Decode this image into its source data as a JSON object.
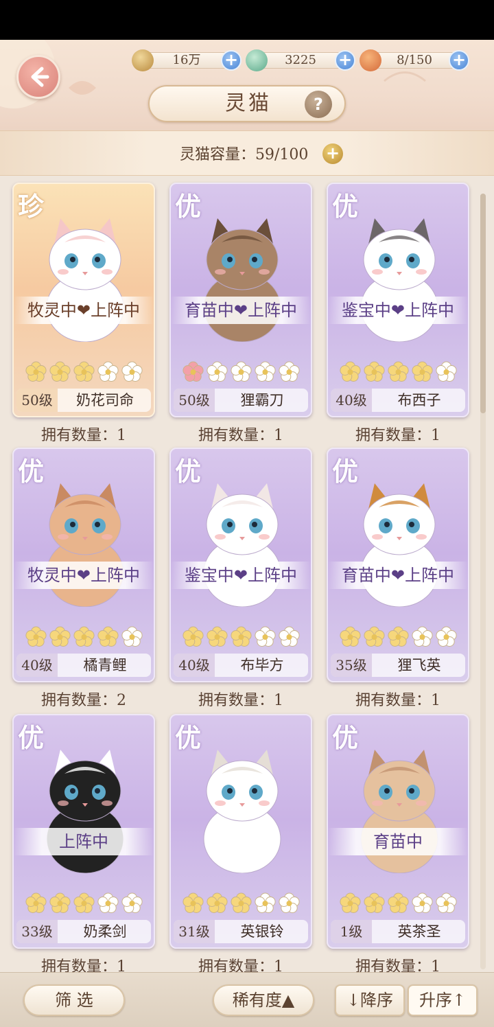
{
  "resources": [
    {
      "icon": "paw-coin-icon",
      "value": "16万"
    },
    {
      "icon": "jade-gem-icon",
      "value": "3225"
    },
    {
      "icon": "food-bowl-icon",
      "value": "8/150"
    }
  ],
  "header": {
    "title": "灵猫",
    "help": "?"
  },
  "capacity": {
    "text": "灵猫容量：59/100"
  },
  "cards": [
    {
      "rarity": "珍",
      "status": "牧灵中❤上阵中",
      "stars": 3,
      "level": "50级",
      "name": "奶花司命",
      "owned": "拥有数量：1"
    },
    {
      "rarity": "优",
      "status": "育苗中❤上阵中",
      "stars": 1,
      "level": "50级",
      "name": "狸霸刀",
      "owned": "拥有数量：1"
    },
    {
      "rarity": "优",
      "status": "鉴宝中❤上阵中",
      "stars": 4,
      "level": "40级",
      "name": "布西子",
      "owned": "拥有数量：1"
    },
    {
      "rarity": "优",
      "status": "牧灵中❤上阵中",
      "stars": 4,
      "level": "40级",
      "name": "橘青鲤",
      "owned": "拥有数量：2"
    },
    {
      "rarity": "优",
      "status": "鉴宝中❤上阵中",
      "stars": 3,
      "level": "40级",
      "name": "布毕方",
      "owned": "拥有数量：1"
    },
    {
      "rarity": "优",
      "status": "育苗中❤上阵中",
      "stars": 3,
      "level": "35级",
      "name": "狸飞英",
      "owned": "拥有数量：1"
    },
    {
      "rarity": "优",
      "status": "上阵中",
      "stars": 3,
      "level": "33级",
      "name": "奶柔剑",
      "owned": "拥有数量：1"
    },
    {
      "rarity": "优",
      "status": "",
      "stars": 3,
      "level": "31级",
      "name": "英银铃",
      "owned": "拥有数量：1"
    },
    {
      "rarity": "优",
      "status": "育苗中",
      "stars": 3,
      "level": "1级",
      "name": "英茶圣",
      "owned": "拥有数量：1"
    }
  ],
  "bottom": {
    "filter": "筛 选",
    "sort": "稀有度▲",
    "desc": "↓降序",
    "asc": "升序↑"
  },
  "colors": {
    "star_gold": "#f6d77c",
    "star_pink": "#f3a0a8",
    "star_empty": "#ffffff",
    "card_purple": "#cab3e6",
    "card_gold": "#f6caa1"
  }
}
